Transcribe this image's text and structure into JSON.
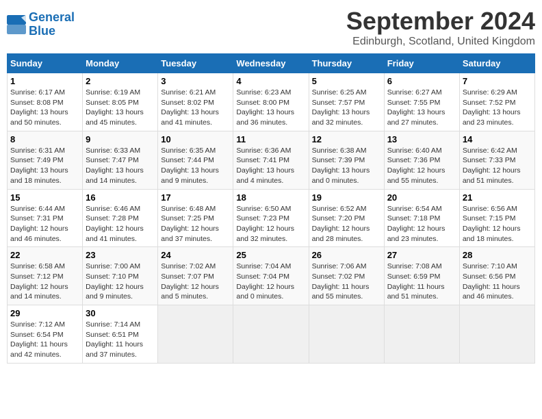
{
  "header": {
    "logo_line1": "General",
    "logo_line2": "Blue",
    "month": "September 2024",
    "location": "Edinburgh, Scotland, United Kingdom"
  },
  "days_of_week": [
    "Sunday",
    "Monday",
    "Tuesday",
    "Wednesday",
    "Thursday",
    "Friday",
    "Saturday"
  ],
  "weeks": [
    [
      {
        "day": "1",
        "info": "Sunrise: 6:17 AM\nSunset: 8:08 PM\nDaylight: 13 hours\nand 50 minutes."
      },
      {
        "day": "2",
        "info": "Sunrise: 6:19 AM\nSunset: 8:05 PM\nDaylight: 13 hours\nand 45 minutes."
      },
      {
        "day": "3",
        "info": "Sunrise: 6:21 AM\nSunset: 8:02 PM\nDaylight: 13 hours\nand 41 minutes."
      },
      {
        "day": "4",
        "info": "Sunrise: 6:23 AM\nSunset: 8:00 PM\nDaylight: 13 hours\nand 36 minutes."
      },
      {
        "day": "5",
        "info": "Sunrise: 6:25 AM\nSunset: 7:57 PM\nDaylight: 13 hours\nand 32 minutes."
      },
      {
        "day": "6",
        "info": "Sunrise: 6:27 AM\nSunset: 7:55 PM\nDaylight: 13 hours\nand 27 minutes."
      },
      {
        "day": "7",
        "info": "Sunrise: 6:29 AM\nSunset: 7:52 PM\nDaylight: 13 hours\nand 23 minutes."
      }
    ],
    [
      {
        "day": "8",
        "info": "Sunrise: 6:31 AM\nSunset: 7:49 PM\nDaylight: 13 hours\nand 18 minutes."
      },
      {
        "day": "9",
        "info": "Sunrise: 6:33 AM\nSunset: 7:47 PM\nDaylight: 13 hours\nand 14 minutes."
      },
      {
        "day": "10",
        "info": "Sunrise: 6:35 AM\nSunset: 7:44 PM\nDaylight: 13 hours\nand 9 minutes."
      },
      {
        "day": "11",
        "info": "Sunrise: 6:36 AM\nSunset: 7:41 PM\nDaylight: 13 hours\nand 4 minutes."
      },
      {
        "day": "12",
        "info": "Sunrise: 6:38 AM\nSunset: 7:39 PM\nDaylight: 13 hours\nand 0 minutes."
      },
      {
        "day": "13",
        "info": "Sunrise: 6:40 AM\nSunset: 7:36 PM\nDaylight: 12 hours\nand 55 minutes."
      },
      {
        "day": "14",
        "info": "Sunrise: 6:42 AM\nSunset: 7:33 PM\nDaylight: 12 hours\nand 51 minutes."
      }
    ],
    [
      {
        "day": "15",
        "info": "Sunrise: 6:44 AM\nSunset: 7:31 PM\nDaylight: 12 hours\nand 46 minutes."
      },
      {
        "day": "16",
        "info": "Sunrise: 6:46 AM\nSunset: 7:28 PM\nDaylight: 12 hours\nand 41 minutes."
      },
      {
        "day": "17",
        "info": "Sunrise: 6:48 AM\nSunset: 7:25 PM\nDaylight: 12 hours\nand 37 minutes."
      },
      {
        "day": "18",
        "info": "Sunrise: 6:50 AM\nSunset: 7:23 PM\nDaylight: 12 hours\nand 32 minutes."
      },
      {
        "day": "19",
        "info": "Sunrise: 6:52 AM\nSunset: 7:20 PM\nDaylight: 12 hours\nand 28 minutes."
      },
      {
        "day": "20",
        "info": "Sunrise: 6:54 AM\nSunset: 7:18 PM\nDaylight: 12 hours\nand 23 minutes."
      },
      {
        "day": "21",
        "info": "Sunrise: 6:56 AM\nSunset: 7:15 PM\nDaylight: 12 hours\nand 18 minutes."
      }
    ],
    [
      {
        "day": "22",
        "info": "Sunrise: 6:58 AM\nSunset: 7:12 PM\nDaylight: 12 hours\nand 14 minutes."
      },
      {
        "day": "23",
        "info": "Sunrise: 7:00 AM\nSunset: 7:10 PM\nDaylight: 12 hours\nand 9 minutes."
      },
      {
        "day": "24",
        "info": "Sunrise: 7:02 AM\nSunset: 7:07 PM\nDaylight: 12 hours\nand 5 minutes."
      },
      {
        "day": "25",
        "info": "Sunrise: 7:04 AM\nSunset: 7:04 PM\nDaylight: 12 hours\nand 0 minutes."
      },
      {
        "day": "26",
        "info": "Sunrise: 7:06 AM\nSunset: 7:02 PM\nDaylight: 11 hours\nand 55 minutes."
      },
      {
        "day": "27",
        "info": "Sunrise: 7:08 AM\nSunset: 6:59 PM\nDaylight: 11 hours\nand 51 minutes."
      },
      {
        "day": "28",
        "info": "Sunrise: 7:10 AM\nSunset: 6:56 PM\nDaylight: 11 hours\nand 46 minutes."
      }
    ],
    [
      {
        "day": "29",
        "info": "Sunrise: 7:12 AM\nSunset: 6:54 PM\nDaylight: 11 hours\nand 42 minutes."
      },
      {
        "day": "30",
        "info": "Sunrise: 7:14 AM\nSunset: 6:51 PM\nDaylight: 11 hours\nand 37 minutes."
      },
      {
        "day": "",
        "info": ""
      },
      {
        "day": "",
        "info": ""
      },
      {
        "day": "",
        "info": ""
      },
      {
        "day": "",
        "info": ""
      },
      {
        "day": "",
        "info": ""
      }
    ]
  ]
}
